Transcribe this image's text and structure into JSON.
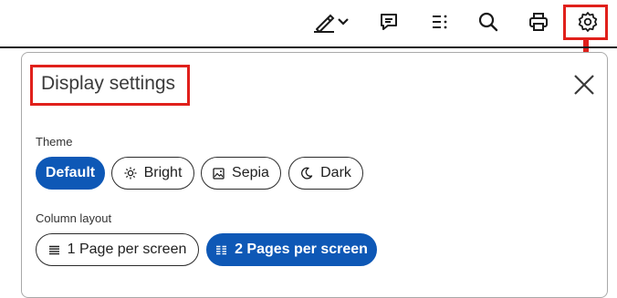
{
  "toolbar": {
    "buttons": [
      {
        "name": "highlighter-icon"
      },
      {
        "name": "comment-icon"
      },
      {
        "name": "list-icon"
      },
      {
        "name": "search-icon"
      },
      {
        "name": "print-icon"
      },
      {
        "name": "gear-icon"
      }
    ]
  },
  "panel": {
    "title": "Display settings",
    "theme": {
      "label": "Theme",
      "options": [
        {
          "label": "Default",
          "active": true
        },
        {
          "label": "Bright",
          "icon": "sun-icon"
        },
        {
          "label": "Sepia",
          "icon": "image-icon"
        },
        {
          "label": "Dark",
          "icon": "moon-icon"
        }
      ]
    },
    "columns": {
      "label": "Column layout",
      "options": [
        {
          "label": "1 Page per screen",
          "icon": "single-column-icon"
        },
        {
          "label": "2 Pages per screen",
          "icon": "two-column-icon",
          "active": true
        }
      ]
    }
  },
  "colors": {
    "accent": "#0e58b6",
    "annotation": "#e0201b"
  }
}
